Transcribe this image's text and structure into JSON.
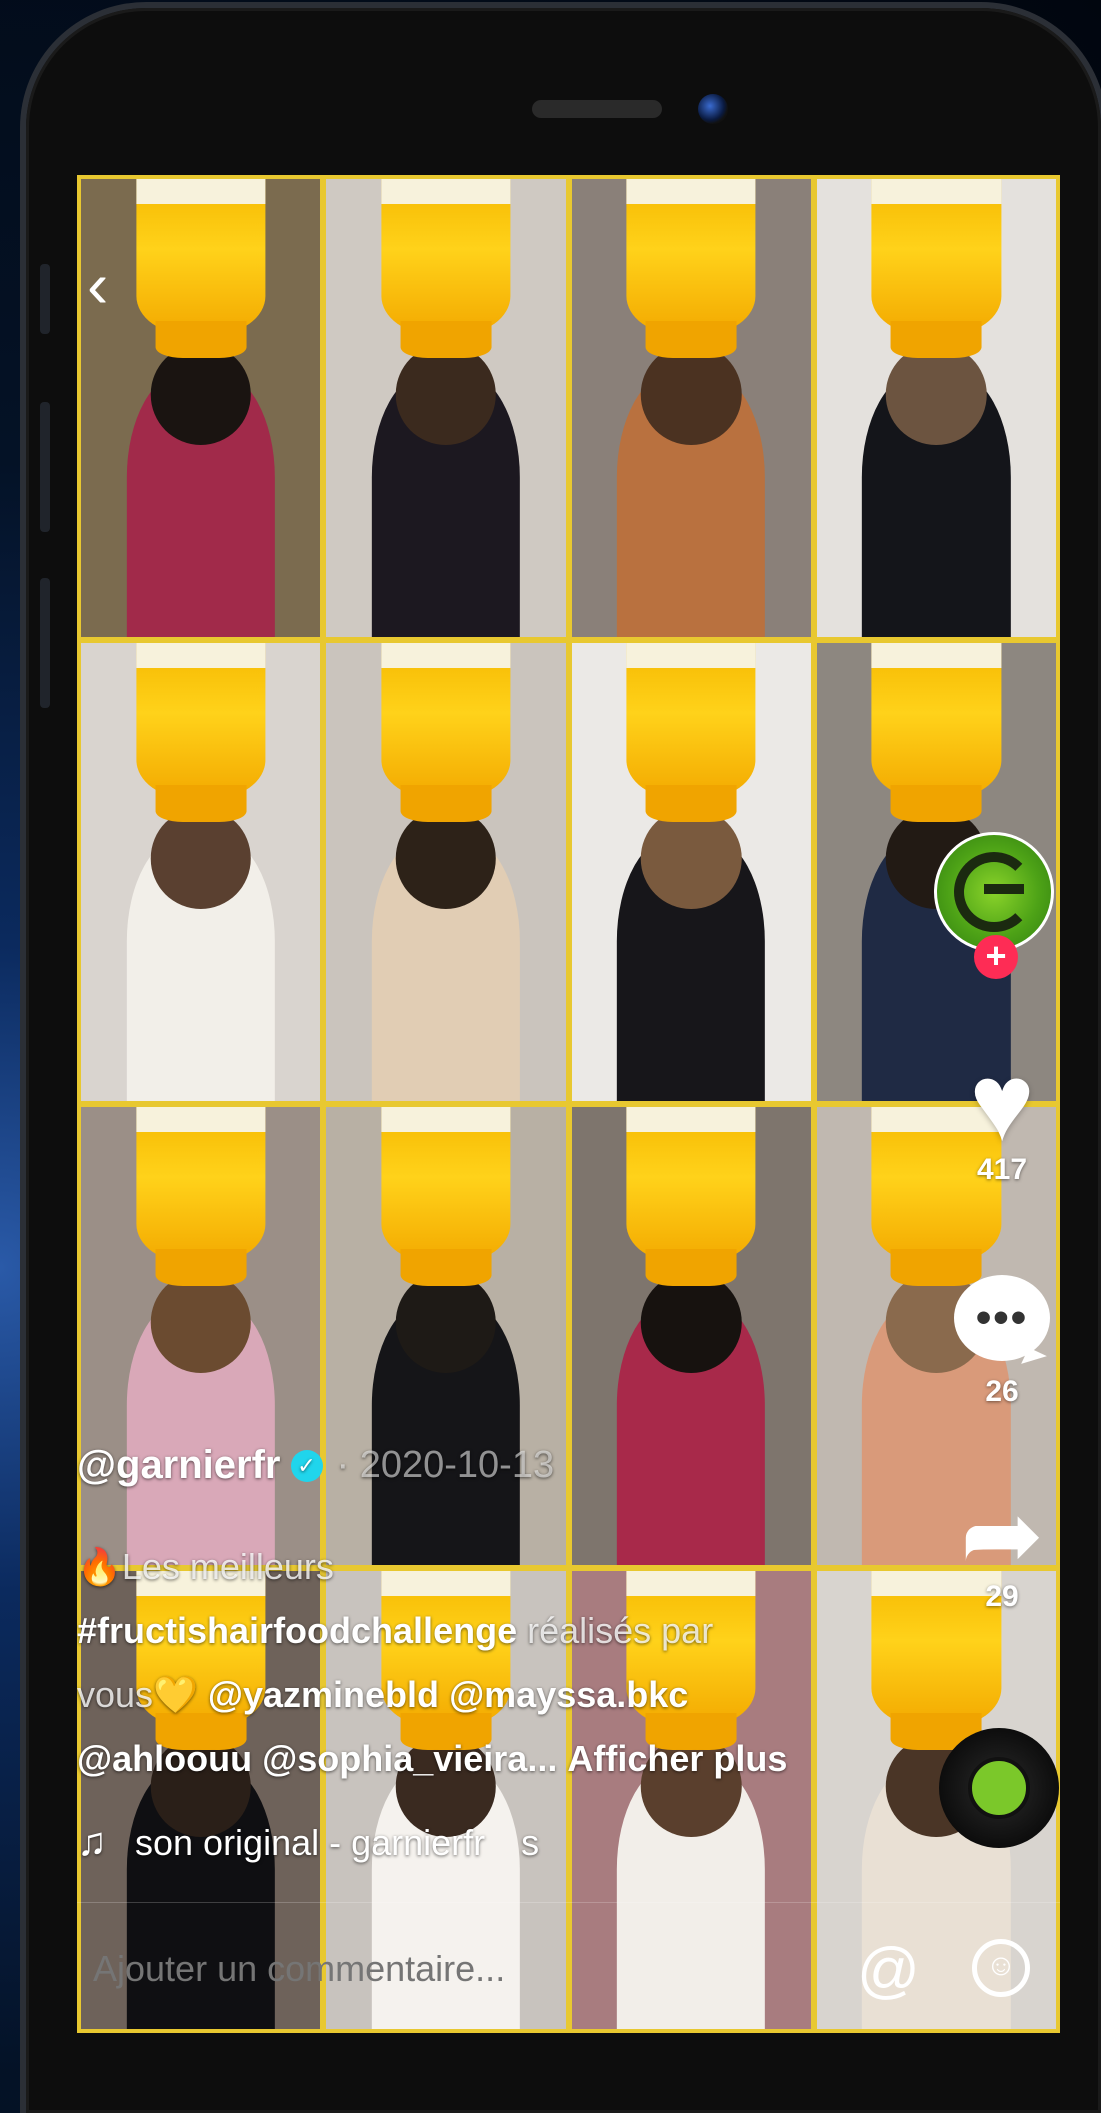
{
  "post": {
    "username": "@garnierfr",
    "date": "· 2020-10-13",
    "caption_line1_emoji": "🔥",
    "caption_line1": "Les meilleurs",
    "hashtag": "#fructishairfoodchallenge",
    "caption_cont": "réalisés par",
    "caption_vous": "vous",
    "heart_emoji": "💛",
    "mention1": "@yazminebld",
    "mention2": "@mayssa.bkc",
    "mention3": "@ahloouu",
    "mention4": "@sophia_vieira...",
    "more": "Afficher plus",
    "music": "son original - garnierfr",
    "music_scroll": "s"
  },
  "actions": {
    "likes": "417",
    "comments": "26",
    "shares": "29",
    "follow": "+",
    "back": "‹"
  },
  "comment": {
    "placeholder": "Ajouter un commentaire...",
    "at": "@",
    "emoji": "☺"
  },
  "colors": {
    "accent_pink": "#fe2c55",
    "verified": "#20d5ec",
    "frame_yellow": "#e8c830"
  },
  "tiles": [
    {
      "bg": "#7b6b4f",
      "shirt": "#a12a4a",
      "hair": "#1a1411"
    },
    {
      "bg": "#cfc9c2",
      "shirt": "#1c1820",
      "hair": "#3b2a1e"
    },
    {
      "bg": "#8a8079",
      "shirt": "#b9713f",
      "hair": "#4b3221"
    },
    {
      "bg": "#e4e1dd",
      "shirt": "#14151a",
      "hair": "#6c5440"
    },
    {
      "bg": "#d9d4cf",
      "shirt": "#f2efe9",
      "hair": "#5a4030"
    },
    {
      "bg": "#cac4bd",
      "shirt": "#e1cdb4",
      "hair": "#2d2218"
    },
    {
      "bg": "#ebe9e6",
      "shirt": "#17161a",
      "hair": "#7a5a3e"
    },
    {
      "bg": "#8d8780",
      "shirt": "#1f2a44",
      "hair": "#221a14"
    },
    {
      "bg": "#9b8f87",
      "shirt": "#d9a8b8",
      "hair": "#6b4b30"
    },
    {
      "bg": "#b8b0a4",
      "shirt": "#151518",
      "hair": "#1e1a16"
    },
    {
      "bg": "#7e756d",
      "shirt": "#a8294a",
      "hair": "#17120f"
    },
    {
      "bg": "#c0b8b0",
      "shirt": "#d99a7a",
      "hair": "#8a6a4d"
    },
    {
      "bg": "#6e625a",
      "shirt": "#0f0f12",
      "hair": "#2a1f18"
    },
    {
      "bg": "#c8c3be",
      "shirt": "#f5f2ee",
      "hair": "#3a2a20"
    },
    {
      "bg": "#a87c7f",
      "shirt": "#f2eee9",
      "hair": "#5a3f2d"
    },
    {
      "bg": "#d8d4cf",
      "shirt": "#e9e0d4",
      "hair": "#4a3526"
    }
  ]
}
